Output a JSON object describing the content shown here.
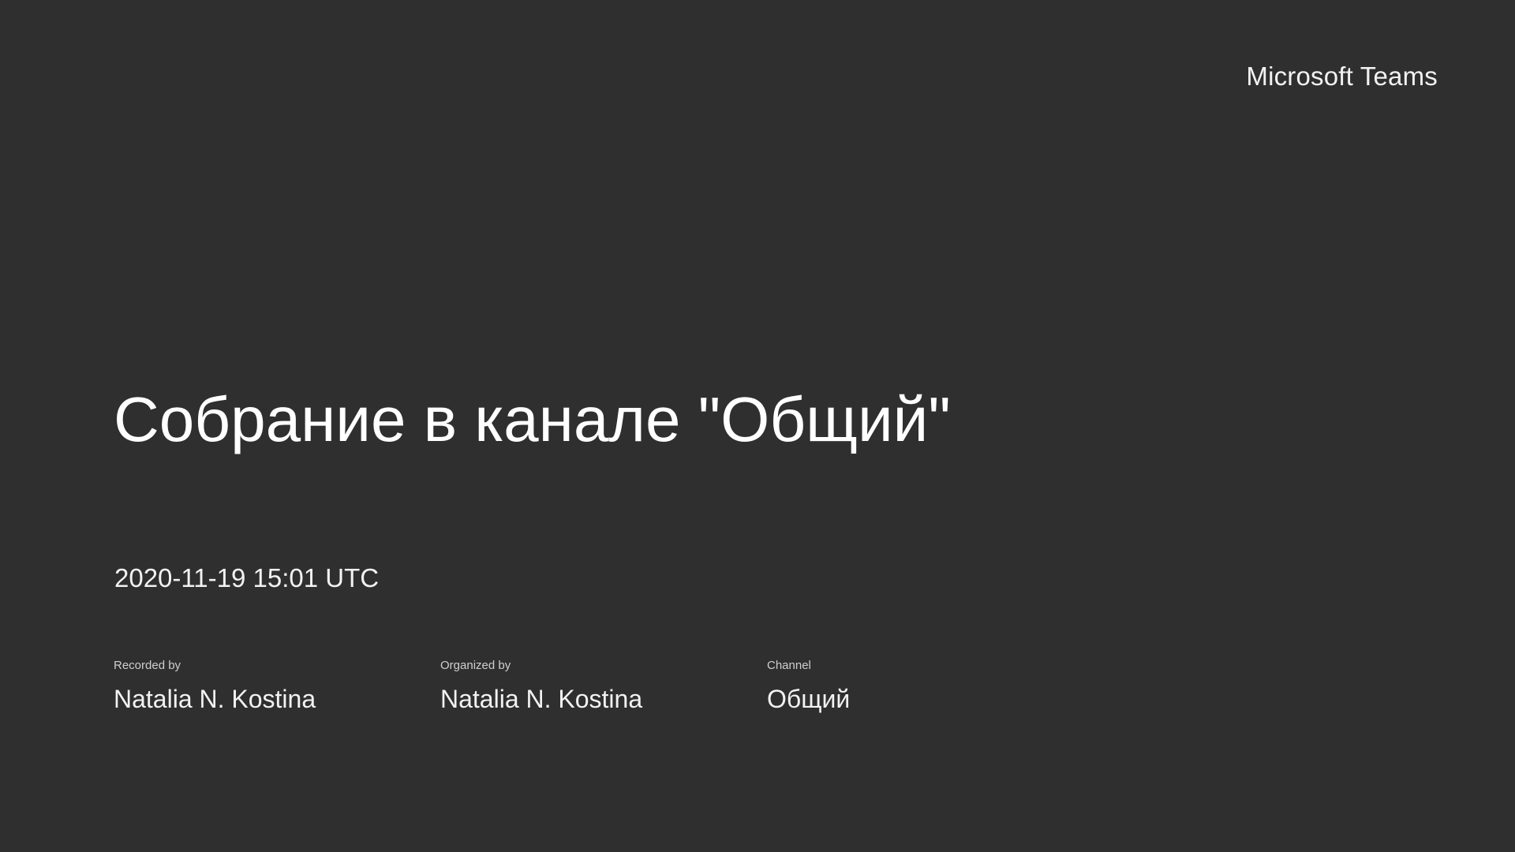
{
  "app": {
    "brand": "Microsoft Teams"
  },
  "meeting": {
    "title": "Собрание в канале \"Общий\"",
    "datetime": "2020-11-19 15:01 UTC"
  },
  "meta": [
    {
      "label": "Recorded by",
      "value": "Natalia N. Kostina"
    },
    {
      "label": "Organized by",
      "value": "Natalia N. Kostina"
    },
    {
      "label": "Channel",
      "value": "Общий"
    }
  ],
  "colors": {
    "background": "#2f2f2f",
    "text": "#ffffff"
  }
}
